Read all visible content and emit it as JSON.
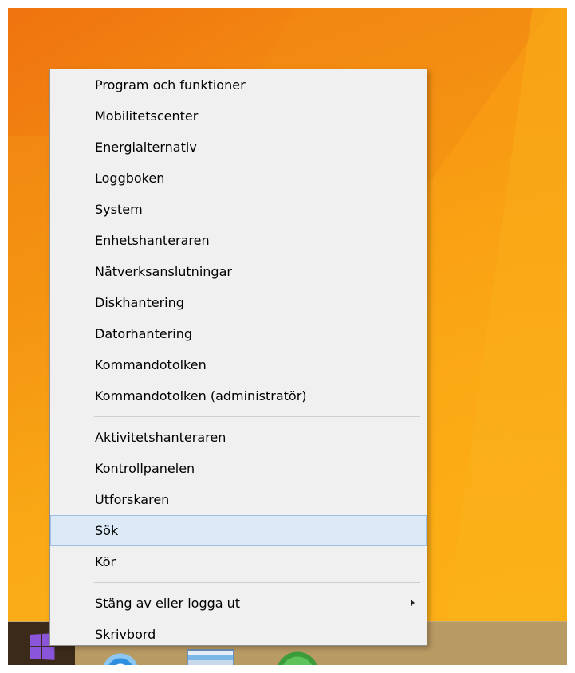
{
  "desktop": {
    "accent_color": "#f6a000"
  },
  "taskbar": {
    "color": "#b89a63",
    "start_logo_color": "#8a55d9",
    "pinned_icons": [
      "internet-explorer-icon",
      "file-explorer-icon",
      "store-icon"
    ]
  },
  "context_menu": {
    "groups": [
      {
        "items": [
          {
            "label": "Program och funktioner"
          },
          {
            "label": "Mobilitetscenter"
          },
          {
            "label": "Energialternativ"
          },
          {
            "label": "Loggboken"
          },
          {
            "label": "System"
          },
          {
            "label": "Enhetshanteraren"
          },
          {
            "label": "Nätverksanslutningar"
          },
          {
            "label": "Diskhantering"
          },
          {
            "label": "Datorhantering"
          },
          {
            "label": "Kommandotolken"
          },
          {
            "label": "Kommandotolken (administratör)"
          }
        ]
      },
      {
        "items": [
          {
            "label": "Aktivitetshanteraren"
          },
          {
            "label": "Kontrollpanelen"
          },
          {
            "label": "Utforskaren"
          },
          {
            "label": "Sök",
            "highlighted": true
          },
          {
            "label": "Kör"
          }
        ]
      },
      {
        "items": [
          {
            "label": "Stäng av eller logga ut",
            "has_submenu": true
          },
          {
            "label": "Skrivbord"
          }
        ]
      }
    ],
    "highlight_color": "#dce9f7"
  }
}
